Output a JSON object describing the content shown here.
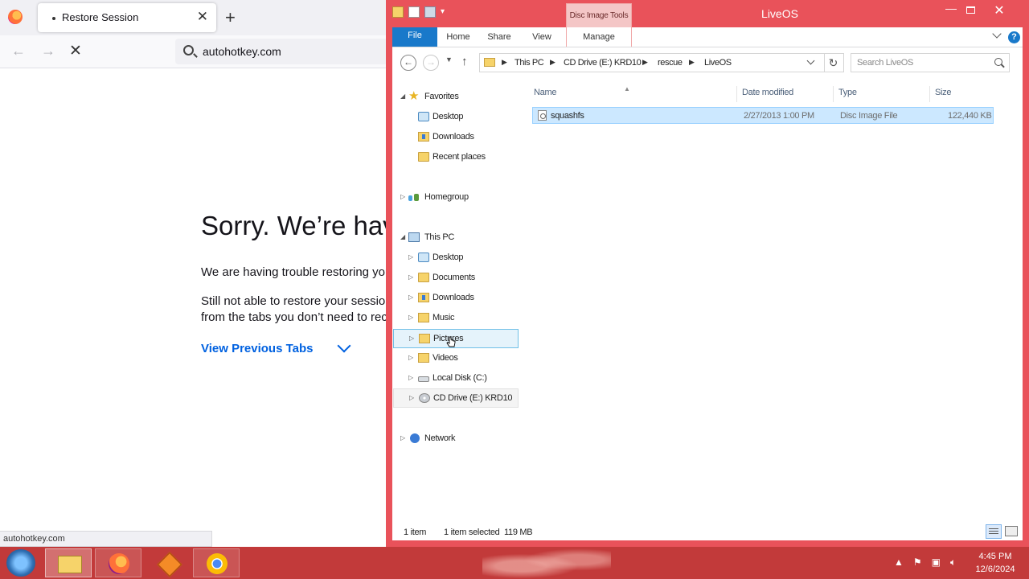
{
  "firefox": {
    "tab_title": "Restore Session",
    "tab_close": "✕",
    "new_tab": "+",
    "url": "autohotkey.com",
    "heading": "Sorry. We’re hav",
    "p1": "We are having trouble restoring you",
    "p2_line1": "Still not able to restore your session",
    "p2_line2": "from the tabs you don’t need to rec",
    "view_previous_tabs": "View Previous Tabs",
    "status_url": "autohotkey.com"
  },
  "explorer": {
    "window_title": "LiveOS",
    "contextual_tab_group": "Disc Image Tools",
    "ribbon_tabs": {
      "file": "File",
      "home": "Home",
      "share": "Share",
      "view": "View",
      "manage": "Manage"
    },
    "breadcrumb": [
      "This PC",
      "CD Drive (E:) KRD10",
      "rescue",
      "LiveOS"
    ],
    "search_placeholder": "Search LiveOS",
    "nav": {
      "favorites": "Favorites",
      "fav_desktop": "Desktop",
      "fav_downloads": "Downloads",
      "fav_recent": "Recent places",
      "homegroup": "Homegroup",
      "thispc": "This PC",
      "pc_desktop": "Desktop",
      "pc_documents": "Documents",
      "pc_downloads": "Downloads",
      "pc_music": "Music",
      "pc_pictures": "Pictures",
      "pc_videos": "Videos",
      "pc_localdisk": "Local Disk (C:)",
      "pc_cddrive": "CD Drive (E:) KRD10",
      "network": "Network"
    },
    "columns": {
      "name": "Name",
      "date_modified": "Date modified",
      "type": "Type",
      "size": "Size"
    },
    "files": [
      {
        "name": "squashfs",
        "date_modified": "2/27/2013 1:00 PM",
        "type": "Disc Image File",
        "size": "122,440 KB"
      }
    ],
    "status": {
      "item_count": "1 item",
      "selection": "1 item selected  119 MB"
    },
    "accent_color": "#e9525a"
  },
  "taskbar": {
    "time": "4:45 PM",
    "date": "12/6/2024"
  }
}
